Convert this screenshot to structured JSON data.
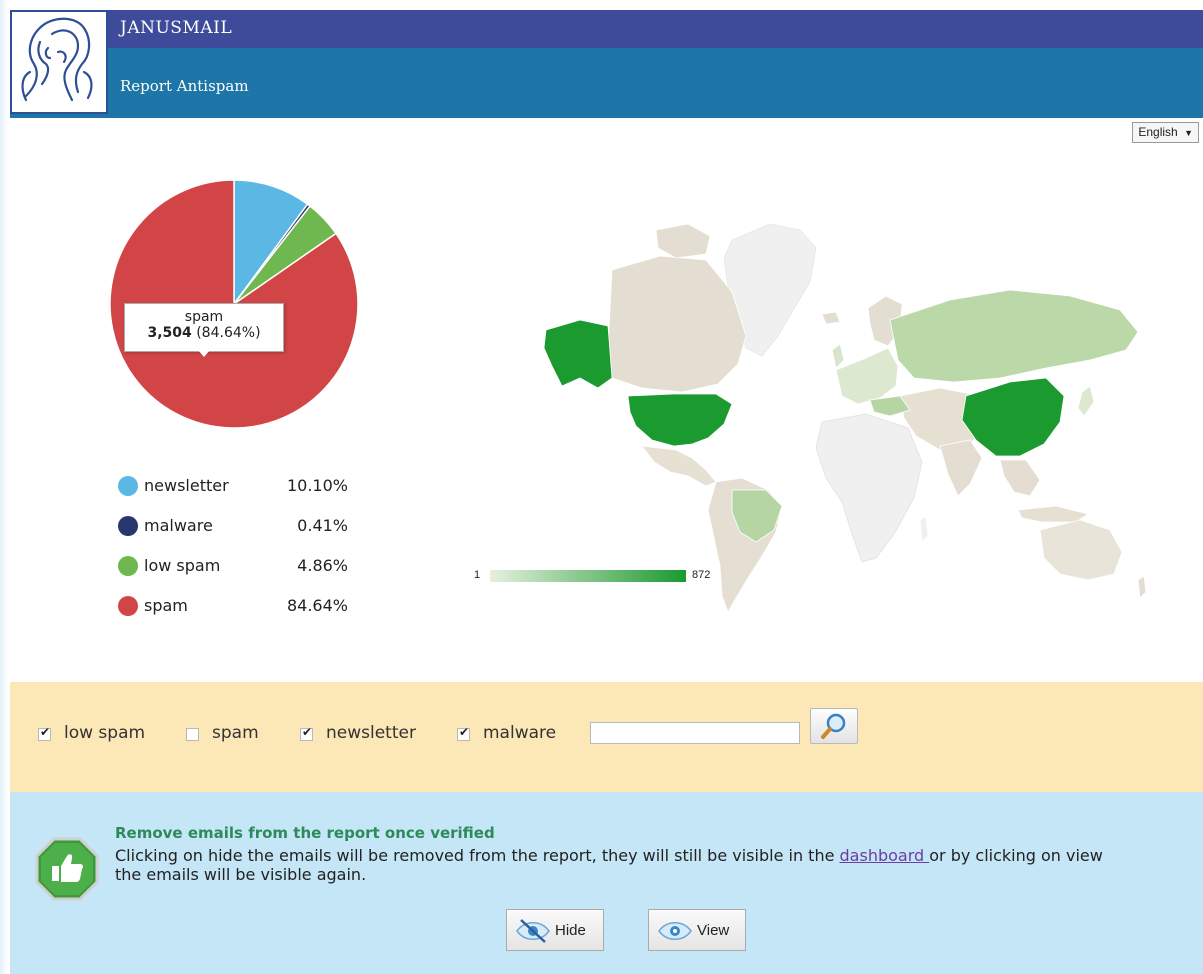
{
  "header": {
    "app_name": "JANUSMAIL",
    "report_title": "Report Antispam",
    "logo_icon": "janus-head-logo"
  },
  "language": {
    "selected": "English"
  },
  "chart_data": {
    "type": "pie",
    "slices": [
      {
        "label": "newsletter",
        "value": 10.1,
        "display": "10.10%",
        "color": "#5bb7e3"
      },
      {
        "label": "malware",
        "value": 0.41,
        "display": "0.41%",
        "color": "#27376e"
      },
      {
        "label": "low spam",
        "value": 4.86,
        "display": "4.86%",
        "color": "#6fb74f"
      },
      {
        "label": "spam",
        "value": 84.64,
        "display": "84.64%",
        "color": "#d24547"
      }
    ],
    "tooltip": {
      "label": "spam",
      "count": "3,504",
      "percent": "(84.64%)"
    }
  },
  "map": {
    "scale_min": "1",
    "scale_max": "872",
    "low_color": "#e8efe0",
    "high_color": "#1a9a2f"
  },
  "filters": {
    "items": [
      {
        "label": "low spam",
        "checked": true
      },
      {
        "label": "spam",
        "checked": false
      },
      {
        "label": "newsletter",
        "checked": true
      },
      {
        "label": "malware",
        "checked": true
      }
    ],
    "search_value": "",
    "search_icon": "magnifier-icon"
  },
  "info": {
    "title": "Remove emails from the report once verified",
    "text_before": "Clicking on hide the emails will be removed from the report, they will still be visible in the ",
    "link": "dashboard ",
    "text_after": "or by clicking on view the emails will be visible again.",
    "badge_icon": "thumbs-up-icon",
    "hide_label": "Hide",
    "view_label": "View"
  }
}
